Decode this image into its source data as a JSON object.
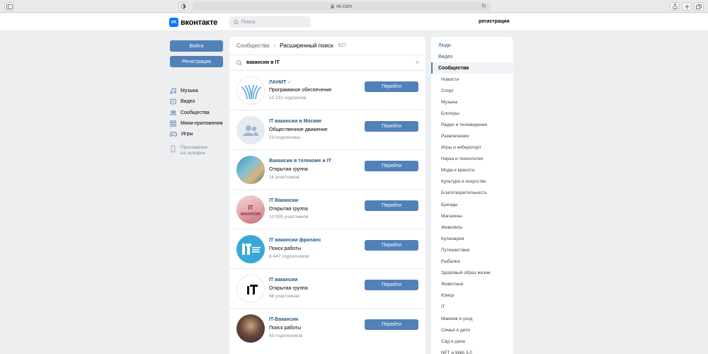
{
  "browser": {
    "url": "vk.com"
  },
  "header": {
    "logo_text": "вконтакте",
    "search_placeholder": "Поиск",
    "register_link": "регистрация"
  },
  "sidebar": {
    "login_button": "Войти",
    "register_button": "Регистрация",
    "items": [
      {
        "label": "Музыка",
        "icon": "music-icon"
      },
      {
        "label": "Видео",
        "icon": "video-icon"
      },
      {
        "label": "Сообщества",
        "icon": "communities-icon"
      },
      {
        "label": "Мини-приложения",
        "icon": "mini-apps-icon"
      },
      {
        "label": "Игры",
        "icon": "gamepad-icon"
      }
    ],
    "app_line1": "Приложение",
    "app_line2": "на телефон"
  },
  "main": {
    "breadcrumb_root": "Сообщества",
    "breadcrumb_current": "Расширенный поиск",
    "result_count": "627",
    "search_value": "вакансии в IT",
    "results": [
      {
        "name": "ЛАНИТ",
        "verified": true,
        "category": "Программное обеспечение",
        "subscribers": "10 231 подписчик",
        "button": "Перейти"
      },
      {
        "name": "IT вакансии в Москве",
        "category": "Общественное движение",
        "subscribers": "23 подписчика",
        "button": "Перейти"
      },
      {
        "name": "Вакансии в телекоме и IT",
        "category": "Открытая группа",
        "subscribers": "16 участников",
        "button": "Перейти"
      },
      {
        "name": "IT Вакансии",
        "category": "Открытая группа",
        "subscribers": "10 939 участников",
        "button": "Перейти"
      },
      {
        "name": "IT вакансии фриланс",
        "category": "Поиск работы",
        "subscribers": "8 447 подписчиков",
        "button": "Перейти"
      },
      {
        "name": "IT вакансии",
        "category": "Открытая группа",
        "subscribers": "88 участников",
        "button": "Перейти"
      },
      {
        "name": "IT-Вакансии",
        "category": "Поиск работы",
        "subscribers": "60 подписчиков",
        "button": "Перейти"
      }
    ]
  },
  "filters": {
    "top": [
      {
        "label": "Люди",
        "active": false
      },
      {
        "label": "Видео",
        "active": false
      },
      {
        "label": "Сообщества",
        "active": true
      }
    ],
    "categories": [
      "Новости",
      "Спорт",
      "Музыка",
      "Блогеры",
      "Радио и телевидение",
      "Развлечения",
      "Игры и киберспорт",
      "Наука и технологии",
      "Мода и красота",
      "Культура и искусство",
      "Благотворительность",
      "Бренды",
      "Магазины",
      "Живопись",
      "Кулинария",
      "Путешествия",
      "Рыбалка",
      "Здоровый образ жизни",
      "Животные",
      "Юмор",
      "IT",
      "Макияж и уход",
      "Семья и дети",
      "Сад и дача",
      "NFT и Web 3.0"
    ]
  },
  "colors": {
    "vk_blue": "#0077ff",
    "button_blue": "#5181b8",
    "link_blue": "#2a5885",
    "page_bg": "#edeef0"
  }
}
